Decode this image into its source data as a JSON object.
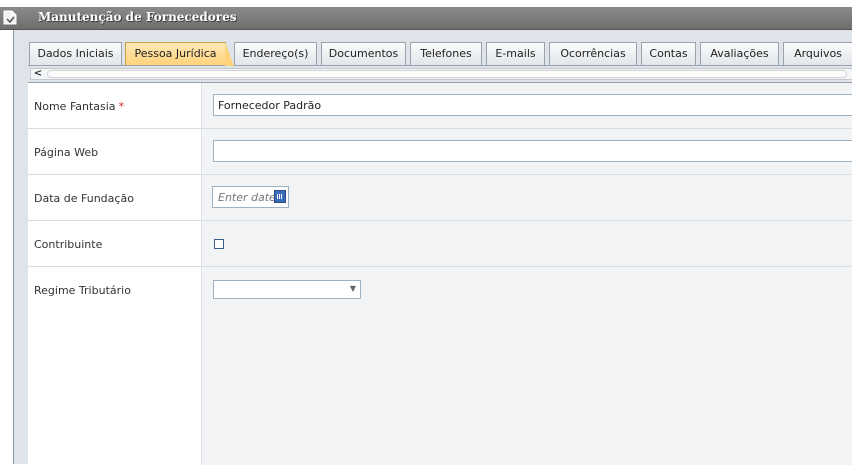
{
  "window": {
    "title": "Manutenção de Fornecedores"
  },
  "tabs": [
    {
      "label": "Dados Iniciais",
      "active": false
    },
    {
      "label": "Pessoa Jurídica",
      "active": true
    },
    {
      "label": "Endereço(s)",
      "active": false
    },
    {
      "label": "Documentos",
      "active": false
    },
    {
      "label": "Telefones",
      "active": false
    },
    {
      "label": "E-mails",
      "active": false
    },
    {
      "label": "Ocorrências",
      "active": false
    },
    {
      "label": "Contas",
      "active": false
    },
    {
      "label": "Avaliações",
      "active": false
    },
    {
      "label": "Arquivos",
      "active": false
    }
  ],
  "scrollbar": {
    "left_arrow": "<"
  },
  "form": {
    "nome_fantasia": {
      "label": "Nome Fantasia",
      "required_mark": "*",
      "value": "Fornecedor Padrão"
    },
    "pagina_web": {
      "label": "Página Web",
      "value": ""
    },
    "data_fundacao": {
      "label": "Data de Fundação",
      "placeholder": "Enter date"
    },
    "contribuinte": {
      "label": "Contribuinte",
      "checked": false
    },
    "regime_tributario": {
      "label": "Regime Tributário",
      "value": "",
      "arrow": "▼"
    }
  },
  "icons": {
    "window": "document-icon",
    "calendar": "calendar-icon"
  }
}
